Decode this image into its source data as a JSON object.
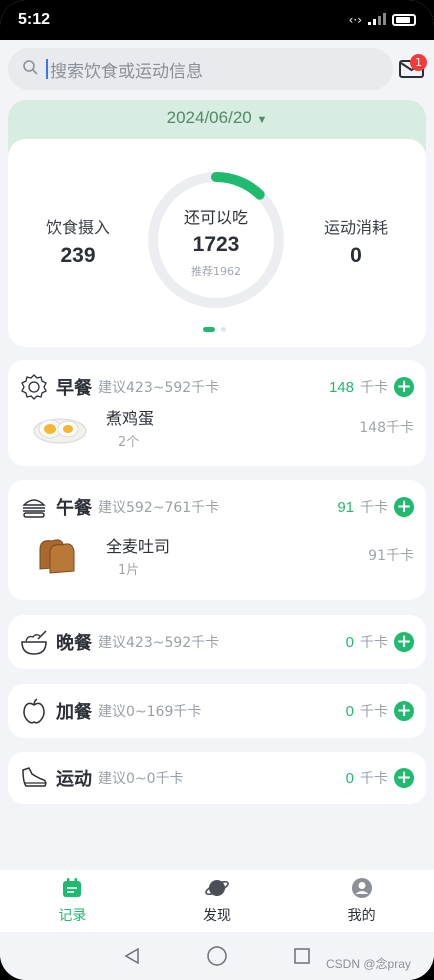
{
  "status": {
    "time": "5:12",
    "signal": "⁴ᴳ"
  },
  "search": {
    "placeholder": "搜索饮食或运动信息",
    "badge": "1"
  },
  "summary": {
    "date": "2024/06/20",
    "intake_label": "饮食摄入",
    "intake_value": "239",
    "remaining_label": "还可以吃",
    "remaining_value": "1723",
    "recommend": "推荐1962",
    "exercise_label": "运动消耗",
    "exercise_value": "0",
    "progress_fraction": 0.122
  },
  "meals": [
    {
      "icon": "breakfast-icon",
      "title": "早餐",
      "suggest": "建议423~592千卡",
      "kcal": "148",
      "unit": "千卡",
      "items": [
        {
          "name": "煮鸡蛋",
          "qty": "2个",
          "kcal": "148千卡",
          "image": "boiled-egg-image"
        }
      ]
    },
    {
      "icon": "burger-icon",
      "title": "午餐",
      "suggest": "建议592~761千卡",
      "kcal": "91",
      "unit": "千卡",
      "items": [
        {
          "name": "全麦吐司",
          "qty": "1片",
          "kcal": "91千卡",
          "image": "toast-image"
        }
      ]
    },
    {
      "icon": "bowl-icon",
      "title": "晚餐",
      "suggest": "建议423~592千卡",
      "kcal": "0",
      "unit": "千卡",
      "items": []
    },
    {
      "icon": "apple-icon",
      "title": "加餐",
      "suggest": "建议0~169千卡",
      "kcal": "0",
      "unit": "千卡",
      "items": []
    },
    {
      "icon": "shoe-icon",
      "title": "运动",
      "suggest": "建议0~0千卡",
      "kcal": "0",
      "unit": "千卡",
      "items": []
    }
  ],
  "nav": [
    {
      "label": "记录",
      "icon": "calendar-icon",
      "active": true
    },
    {
      "label": "发现",
      "icon": "planet-icon",
      "active": false
    },
    {
      "label": "我的",
      "icon": "user-icon",
      "active": false
    }
  ],
  "watermark": "CSDN @念pray",
  "colors": {
    "accent": "#1fba6e",
    "header_bg": "#d7ede1",
    "badge": "#f43a3a"
  }
}
